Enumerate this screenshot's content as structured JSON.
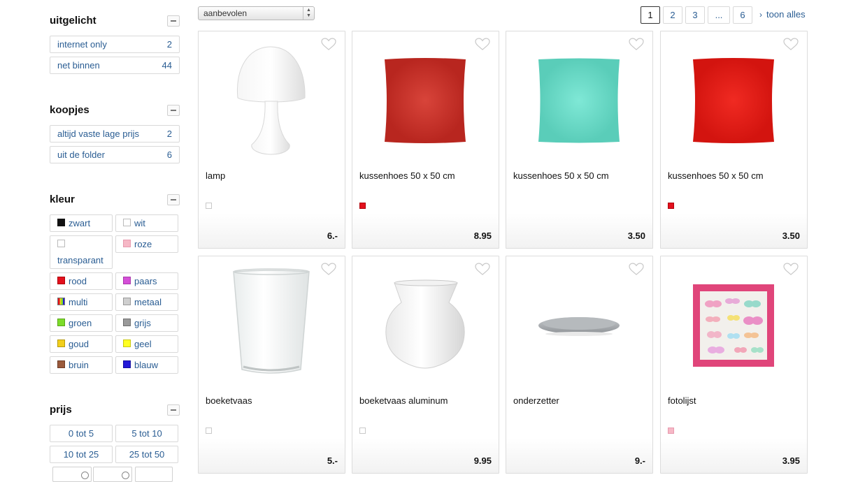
{
  "sidebar": {
    "sections": [
      {
        "title": "uitgelicht",
        "items": [
          {
            "label": "internet only",
            "count": "2"
          },
          {
            "label": "net binnen",
            "count": "44"
          }
        ]
      },
      {
        "title": "koopjes",
        "items": [
          {
            "label": "altijd vaste lage prijs",
            "count": "2"
          },
          {
            "label": "uit de folder",
            "count": "6"
          }
        ]
      },
      {
        "title": "kleur",
        "colors": [
          {
            "label": "zwart",
            "swatch": "#111111"
          },
          {
            "label": "wit",
            "swatch": "#ffffff"
          },
          {
            "label": "transparant",
            "swatch": "#ffffff"
          },
          {
            "label": "roze",
            "swatch": "#f6b8c6"
          },
          {
            "label": "rood",
            "swatch": "#e3101d"
          },
          {
            "label": "paars",
            "swatch": "#d54fd8"
          },
          {
            "label": "multi",
            "swatch": "multi"
          },
          {
            "label": "metaal",
            "swatch": "#cfcfcf"
          },
          {
            "label": "groen",
            "swatch": "#7ddc2a"
          },
          {
            "label": "grijs",
            "swatch": "#9a9a9a"
          },
          {
            "label": "goud",
            "swatch": "#f2cf1c"
          },
          {
            "label": "geel",
            "swatch": "#ffff22"
          },
          {
            "label": "bruin",
            "swatch": "#9a5a3c"
          },
          {
            "label": "blauw",
            "swatch": "#2419d8"
          }
        ]
      },
      {
        "title": "prijs",
        "ranges": [
          "0 tot 5",
          "5 tot 10",
          "10 tot 25",
          "25 tot 50"
        ]
      }
    ]
  },
  "toolbar": {
    "sort_value": "aanbevolen",
    "pages": [
      "1",
      "2",
      "3",
      "...",
      "6"
    ],
    "active_page": "1",
    "show_all": "toon alles"
  },
  "products": [
    {
      "name": "lamp",
      "price": "6.-",
      "color_swatch": "#ffffff",
      "icon": "table-lamp-image"
    },
    {
      "name": "kussenhoes 50 x 50 cm",
      "price": "8.95",
      "color_swatch": "#e3101d",
      "icon": "red-cushion-image"
    },
    {
      "name": "kussenhoes 50 x 50 cm",
      "price": "3.50",
      "color_swatch": null,
      "icon": "turquoise-cushion-image"
    },
    {
      "name": "kussenhoes 50 x 50 cm",
      "price": "3.50",
      "color_swatch": "#e3101d",
      "icon": "red-cushion-image"
    },
    {
      "name": "boeketvaas",
      "price": "5.-",
      "color_swatch": "#ffffff",
      "icon": "glass-vase-image"
    },
    {
      "name": "boeketvaas aluminum",
      "price": "9.95",
      "color_swatch": "#ffffff",
      "icon": "white-vase-image"
    },
    {
      "name": "onderzetter",
      "price": "9.-",
      "color_swatch": null,
      "icon": "coaster-plate-image"
    },
    {
      "name": "fotolijst",
      "price": "3.95",
      "color_swatch": "#f6b8c6",
      "icon": "photo-frame-image"
    }
  ],
  "colors": {
    "link": "#2a5d93",
    "border": "#d9d9d9",
    "cushion_red": "#d8322a",
    "cushion_turquoise": "#6fe0cd",
    "frame_pink": "#e0457a"
  }
}
